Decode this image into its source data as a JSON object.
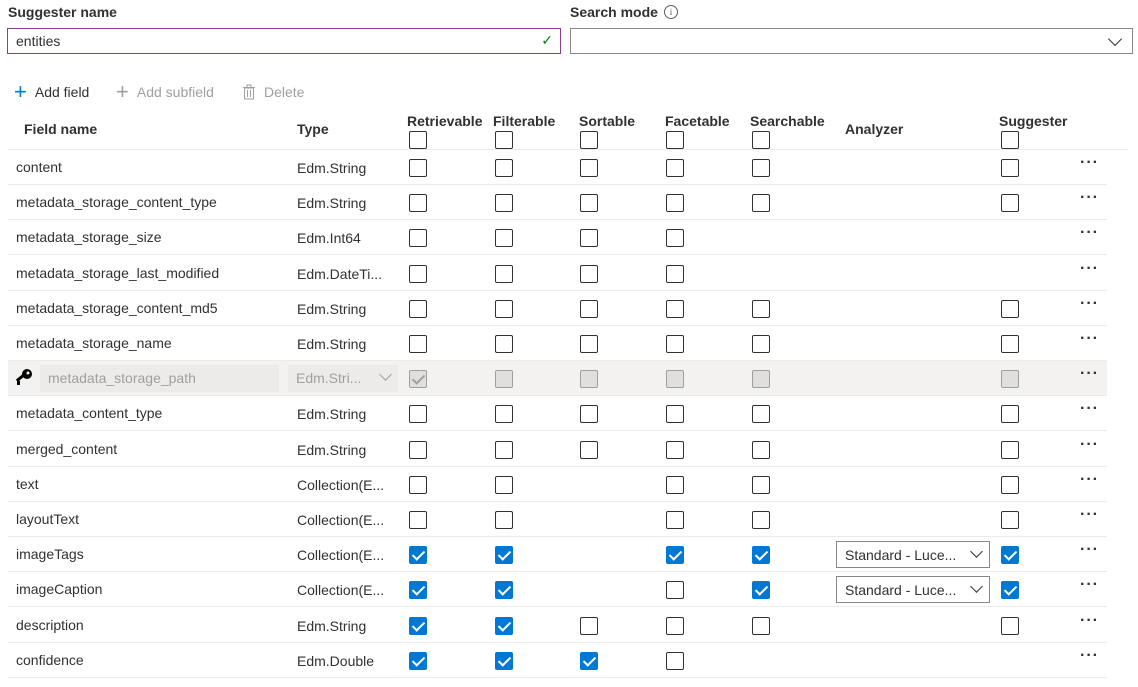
{
  "suggester": {
    "name_label": "Suggester name",
    "name_value": "entities",
    "mode_label": "Search mode",
    "mode_value": ""
  },
  "toolbar": {
    "add_field": "Add field",
    "add_subfield": "Add subfield",
    "delete": "Delete"
  },
  "columns": {
    "field_name": "Field name",
    "type": "Type",
    "retrievable": "Retrievable",
    "filterable": "Filterable",
    "sortable": "Sortable",
    "facetable": "Facetable",
    "searchable": "Searchable",
    "analyzer": "Analyzer",
    "suggester": "Suggester"
  },
  "rows": [
    {
      "name": "content",
      "type": "Edm.String",
      "retrievable": false,
      "filterable": false,
      "sortable": false,
      "facetable": false,
      "searchable": false,
      "analyzer": "",
      "suggester": false
    },
    {
      "name": "metadata_storage_content_type",
      "type": "Edm.String",
      "retrievable": false,
      "filterable": false,
      "sortable": false,
      "facetable": false,
      "searchable": false,
      "analyzer": "",
      "suggester": false
    },
    {
      "name": "metadata_storage_size",
      "type": "Edm.Int64",
      "retrievable": false,
      "filterable": false,
      "sortable": false,
      "facetable": false,
      "searchable": null,
      "analyzer": "",
      "suggester": null
    },
    {
      "name": "metadata_storage_last_modified",
      "type": "Edm.DateTi...",
      "retrievable": false,
      "filterable": false,
      "sortable": false,
      "facetable": false,
      "searchable": null,
      "analyzer": "",
      "suggester": null
    },
    {
      "name": "metadata_storage_content_md5",
      "type": "Edm.String",
      "retrievable": false,
      "filterable": false,
      "sortable": false,
      "facetable": false,
      "searchable": false,
      "analyzer": "",
      "suggester": false
    },
    {
      "name": "metadata_storage_name",
      "type": "Edm.String",
      "retrievable": false,
      "filterable": false,
      "sortable": false,
      "facetable": false,
      "searchable": false,
      "analyzer": "",
      "suggester": false
    },
    {
      "name": "metadata_storage_path",
      "type": "Edm.Stri...",
      "key": true,
      "retrievable": true,
      "filterable": false,
      "sortable": false,
      "facetable": false,
      "searchable": false,
      "analyzer": "",
      "suggester": false
    },
    {
      "name": "metadata_content_type",
      "type": "Edm.String",
      "retrievable": false,
      "filterable": false,
      "sortable": false,
      "facetable": false,
      "searchable": false,
      "analyzer": "",
      "suggester": false
    },
    {
      "name": "merged_content",
      "type": "Edm.String",
      "retrievable": false,
      "filterable": false,
      "sortable": false,
      "facetable": false,
      "searchable": false,
      "analyzer": "",
      "suggester": false
    },
    {
      "name": "text",
      "type": "Collection(E...",
      "retrievable": false,
      "filterable": false,
      "sortable": null,
      "facetable": false,
      "searchable": false,
      "analyzer": "",
      "suggester": false
    },
    {
      "name": "layoutText",
      "type": "Collection(E...",
      "retrievable": false,
      "filterable": false,
      "sortable": null,
      "facetable": false,
      "searchable": false,
      "analyzer": "",
      "suggester": false
    },
    {
      "name": "imageTags",
      "type": "Collection(E...",
      "retrievable": true,
      "filterable": true,
      "sortable": null,
      "facetable": true,
      "searchable": true,
      "analyzer": "Standard - Luce...",
      "suggester": true
    },
    {
      "name": "imageCaption",
      "type": "Collection(E...",
      "retrievable": true,
      "filterable": true,
      "sortable": null,
      "facetable": false,
      "searchable": true,
      "analyzer": "Standard - Luce...",
      "suggester": true
    },
    {
      "name": "description",
      "type": "Edm.String",
      "retrievable": true,
      "filterable": true,
      "sortable": false,
      "facetable": false,
      "searchable": false,
      "analyzer": "",
      "suggester": false
    },
    {
      "name": "confidence",
      "type": "Edm.Double",
      "retrievable": true,
      "filterable": true,
      "sortable": true,
      "facetable": false,
      "searchable": null,
      "analyzer": "",
      "suggester": null
    }
  ],
  "icons": {
    "key": "key-icon",
    "more": "more-icon",
    "add": "plus-icon",
    "delete": "trash-icon"
  },
  "colors": {
    "accent": "#0078d4",
    "focus_border": "#8a3d8f",
    "valid_check": "#107c10"
  }
}
